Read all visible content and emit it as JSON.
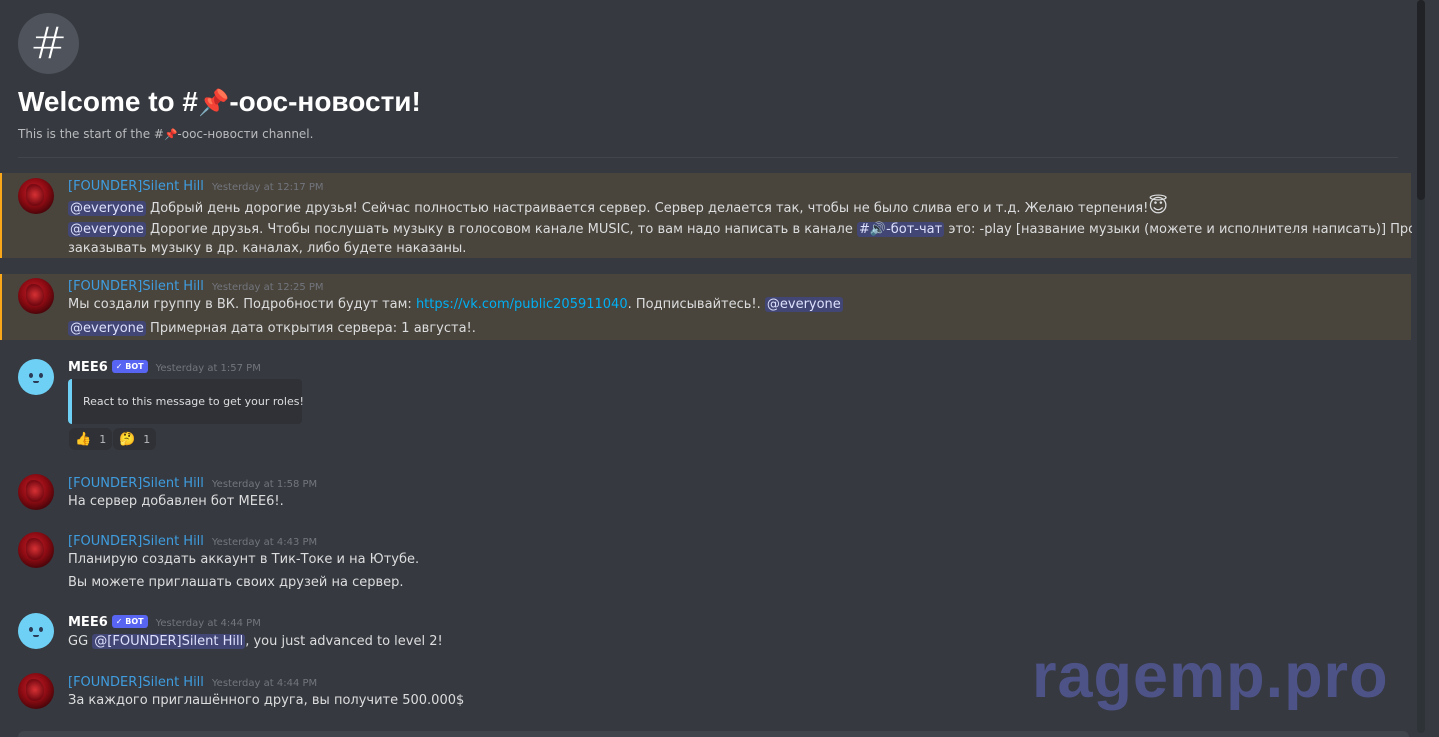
{
  "channel": {
    "hash": "#",
    "welcome_prefix": "Welcome to #",
    "channel_emoji": "📌",
    "channel_name": "-оос-новости!",
    "start_prefix": "This is the start of the #",
    "start_name": "-оос-новости channel."
  },
  "messages": [
    {
      "author": "[FOUNDER]Silent Hill",
      "timestamp": "Yesterday at 12:17 PM",
      "line1_mention": "@everyone",
      "line1_text": " Добрый день дорогие друзья! Сейчас полностью настраивается сервер. Сервер делается так, чтобы не было слива его и т.д. Желаю терпения!",
      "line1_emoji": "😇",
      "line2_mention": "@everyone",
      "line2_text": " Дорогие друзья. Чтобы послушать музыку в голосовом канале MUSIC, то вам надо написать в канале ",
      "line2_channel_hash": "#",
      "line2_channel_emoji": "🔊",
      "line2_channel_name": "-бот-чат",
      "line2_text_after": "  это: -play [название музыки (можете и исполнителя написать)] Просьба не",
      "line3_text": "заказывать музыку в др. каналах, либо будете наказаны."
    },
    {
      "author": "[FOUNDER]Silent Hill",
      "timestamp": "Yesterday at 12:25 PM",
      "line1_text": "Мы создали группу в ВК. Подробности будут там: ",
      "line1_link": "https://vk.com/public205911040",
      "line1_after": ". Подписывайтесь!. ",
      "line1_mention": "@everyone",
      "line2_mention": "@everyone",
      "line2_text": "  Примерная дата открытия сервера: 1 августа!."
    },
    {
      "author": "MEE6",
      "bot_tag": "✓ BOT",
      "timestamp": "Yesterday at 1:57 PM",
      "embed_text": "React to this message to get your roles!",
      "reactions": [
        {
          "emoji": "👍",
          "count": "1"
        },
        {
          "emoji": "🤔",
          "count": "1"
        }
      ]
    },
    {
      "author": "[FOUNDER]Silent Hill",
      "timestamp": "Yesterday at 1:58 PM",
      "line1_text": "На сервер добавлен бот MEE6!."
    },
    {
      "author": "[FOUNDER]Silent Hill",
      "timestamp": "Yesterday at 4:43 PM",
      "line1_text": "Планирую создать аккаунт в Тик-Токе и на Ютубе.",
      "line2_text": "Вы можете приглашать своих друзей на сервер."
    },
    {
      "author": "MEE6",
      "bot_tag": "✓ BOT",
      "timestamp": "Yesterday at 4:44 PM",
      "line1_text": "GG ",
      "line1_mention": "@[FOUNDER]Silent Hill",
      "line1_after": ", you just advanced to level 2!"
    },
    {
      "author": "[FOUNDER]Silent Hill",
      "timestamp": "Yesterday at 4:44 PM",
      "line1_text": "За каждого приглашённого друга, вы получите 500.000$"
    }
  ],
  "watermark": "ragemp.pro"
}
